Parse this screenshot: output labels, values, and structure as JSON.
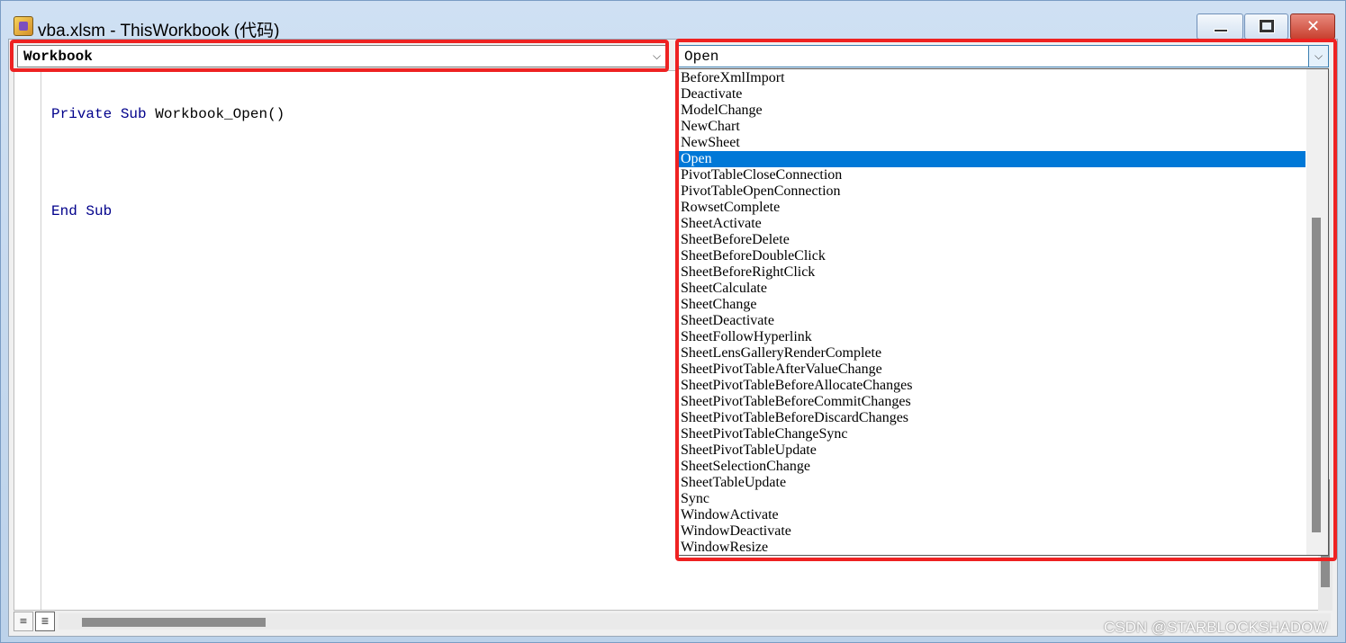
{
  "window": {
    "title": "vba.xlsm - ThisWorkbook (代码)",
    "min_icon": "minimize-icon",
    "max_icon": "restore-icon",
    "close_glyph": "✕"
  },
  "object_combo": {
    "value": "Workbook"
  },
  "procedure_combo": {
    "value": "Open"
  },
  "code": {
    "line1_kw1": "Private",
    "line1_kw2": "Sub",
    "line1_rest": " Workbook_Open()",
    "line2_kw1": "End",
    "line2_kw2": "Sub"
  },
  "dropdown": {
    "items": [
      "BeforeXmlImport",
      "Deactivate",
      "ModelChange",
      "NewChart",
      "NewSheet",
      "Open",
      "PivotTableCloseConnection",
      "PivotTableOpenConnection",
      "RowsetComplete",
      "SheetActivate",
      "SheetBeforeDelete",
      "SheetBeforeDoubleClick",
      "SheetBeforeRightClick",
      "SheetCalculate",
      "SheetChange",
      "SheetDeactivate",
      "SheetFollowHyperlink",
      "SheetLensGalleryRenderComplete",
      "SheetPivotTableAfterValueChange",
      "SheetPivotTableBeforeAllocateChanges",
      "SheetPivotTableBeforeCommitChanges",
      "SheetPivotTableBeforeDiscardChanges",
      "SheetPivotTableChangeSync",
      "SheetPivotTableUpdate",
      "SheetSelectionChange",
      "SheetTableUpdate",
      "Sync",
      "WindowActivate",
      "WindowDeactivate",
      "WindowResize"
    ],
    "selected": "Open"
  },
  "colors": {
    "selection": "#0078d7",
    "highlight_box": "#ee2222",
    "keyword": "#00008b"
  },
  "watermark": "CSDN @STARBLOCKSHADOW"
}
